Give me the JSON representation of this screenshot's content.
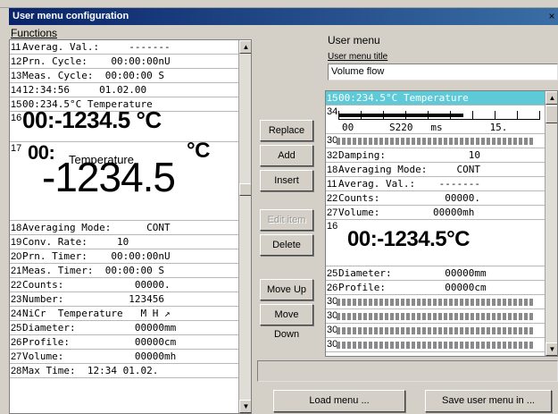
{
  "title": "User menu configuration",
  "close_glyph": "×",
  "functions": {
    "label": "Functions",
    "rows": [
      {
        "num": "11",
        "text": "Averag. Val.:     -------"
      },
      {
        "num": "12",
        "text": "Prn. Cycle:    00:00:00nU"
      },
      {
        "num": "13",
        "text": "Meas. Cycle:  00:00:00 S"
      },
      {
        "num": "14",
        "text": "12:34:56     01.02.00"
      },
      {
        "num": "15",
        "text": "00:234.5°C Temperature"
      }
    ],
    "big16": {
      "num": "16",
      "text": "00:-1234.5 °C"
    },
    "big17": {
      "num": "17",
      "prefix": "00:",
      "label": "Temperature",
      "unit": "°C",
      "value": "-1234.5"
    },
    "rows2": [
      {
        "num": "18",
        "text": "Averaging Mode:      CONT"
      },
      {
        "num": "19",
        "text": "Conv. Rate:     10"
      },
      {
        "num": "20",
        "text": "Prn. Timer:    00:00:00nU"
      },
      {
        "num": "21",
        "text": "Meas. Timer:  00:00:00 S"
      },
      {
        "num": "22",
        "text": "Counts:            00000."
      },
      {
        "num": "23",
        "text": "Number:           123456"
      },
      {
        "num": "24",
        "text": "NiCr  Temperature   M H ↗"
      },
      {
        "num": "25",
        "text": "Diameter:          00000mm"
      },
      {
        "num": "26",
        "text": "Profile:           00000cm"
      },
      {
        "num": "27",
        "text": "Volume:            00000mh"
      },
      {
        "num": "28",
        "text": "Max Time:  12:34 01.02."
      }
    ]
  },
  "buttons": {
    "replace": "Replace",
    "add": "Add",
    "insert": "Insert",
    "edit_item": "Edit item",
    "delete": "Delete",
    "move_up": "Move Up",
    "move_down": "Move Down",
    "load_menu": "Load menu ...",
    "save_menu": "Save user menu in ..."
  },
  "user_menu": {
    "label": "User menu",
    "title_label": "User menu title",
    "title_value": "Volume flow",
    "rows_top": [
      {
        "num": "15",
        "text": "00:234.5°C Temperature",
        "selected": true
      }
    ],
    "bar34": {
      "num": "34",
      "scale": "00      S220   ms        15."
    },
    "stripe30": {
      "num": "30"
    },
    "rows_mid": [
      {
        "num": "32",
        "text": "Damping:              10"
      },
      {
        "num": "18",
        "text": "Averaging Mode:     CONT"
      },
      {
        "num": "11",
        "text": "Averag. Val.:    -------"
      },
      {
        "num": "22",
        "text": "Counts:           00000."
      },
      {
        "num": "27",
        "text": "Volume:         00000mh"
      }
    ],
    "big16": {
      "num": "16",
      "text": "00:-1234.5°C"
    },
    "rows_bot": [
      {
        "num": "25",
        "text": "Diameter:         00000mm"
      },
      {
        "num": "26",
        "text": "Profile:          00000cm"
      }
    ],
    "stripes": [
      "30",
      "30",
      "30",
      "30"
    ]
  },
  "colors": {
    "selection": "#5ec9d7",
    "titlebar": "#0a246a"
  }
}
